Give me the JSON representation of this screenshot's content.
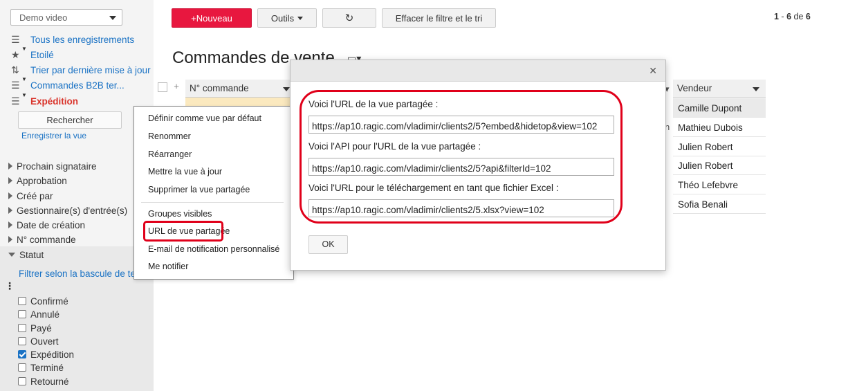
{
  "sidebar": {
    "view_select": "Demo video",
    "nav": [
      {
        "icon": "list-icon",
        "label": "Tous les enregistrements"
      },
      {
        "icon": "star-icon",
        "label": "Etoilé"
      },
      {
        "icon": "sort-icon",
        "label": "Trier par dernière mise à jour"
      },
      {
        "icon": "filter-list-icon",
        "label": "Commandes B2B ter..."
      },
      {
        "icon": "filter-list-icon",
        "label": "Expédition"
      }
    ],
    "search_button": "Rechercher",
    "save_view": "Enregistrer la vue",
    "filters": [
      "Prochain signataire",
      "Approbation",
      "Créé par",
      "Gestionnaire(s) d'entrée(s)",
      "Date de création",
      "N° commande",
      "Statut"
    ],
    "toggle_link": "Filtrer selon la bascule de te",
    "status_options": [
      {
        "label": "Confirmé",
        "checked": false
      },
      {
        "label": "Annulé",
        "checked": false
      },
      {
        "label": "Payé",
        "checked": false
      },
      {
        "label": "Ouvert",
        "checked": false
      },
      {
        "label": "Expédition",
        "checked": true
      },
      {
        "label": "Terminé",
        "checked": false
      },
      {
        "label": "Retourné",
        "checked": false
      }
    ]
  },
  "toolbar": {
    "new_label": "+Nouveau",
    "tools_label": "Outils",
    "refresh_icon": "refresh-icon",
    "clear_label": "Effacer le filtre et le tri",
    "pager_from": "1",
    "pager_to": "6",
    "pager_sep": "de",
    "pager_total": "6"
  },
  "page": {
    "title": "Commandes de vente"
  },
  "table": {
    "col_order": "N° commande",
    "col_vendor": "Vendeur",
    "vendors": [
      "Camille Dupont",
      "Mathieu Dubois",
      "Julien Robert",
      "Julien Robert",
      "Théo Lefebvre",
      "Sofia Benali"
    ]
  },
  "context_menu": {
    "items_top": [
      "Définir comme vue par défaut",
      "Renommer",
      "Réarranger",
      "Mettre la vue à jour",
      "Supprimer la vue partagée"
    ],
    "items_bottom": [
      "Groupes visibles",
      "URL de vue partagée",
      "E-mail de notification personnalisé",
      "Me notifier"
    ]
  },
  "dialog": {
    "label_shared": "Voici l'URL de la vue partagée :",
    "url_shared": "https://ap10.ragic.com/vladimir/clients2/5?embed&hidetop&view=102",
    "label_api": "Voici l'API pour l'URL de la vue partagée :",
    "url_api": "https://ap10.ragic.com/vladimir/clients2/5?api&filterId=102",
    "label_excel": "Voici l'URL pour le téléchargement en tant que fichier Excel :",
    "url_excel": "https://ap10.ragic.com/vladimir/clients2/5.xlsx?view=102",
    "ok_label": "OK",
    "close_icon": "close-icon"
  },
  "colors": {
    "accent_red": "#e8173f",
    "link_blue": "#1a72c4",
    "highlight_red": "#e0001a"
  }
}
